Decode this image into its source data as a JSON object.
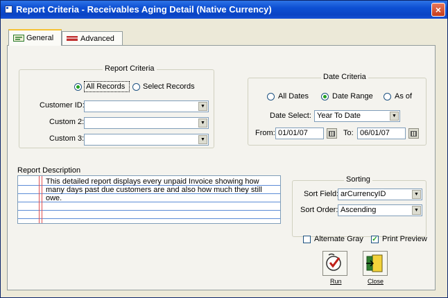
{
  "window": {
    "title": "Report Criteria - Receivables Aging Detail (Native Currency)",
    "close_glyph": "×"
  },
  "tabs": [
    {
      "label": "General",
      "icon": "form-icon"
    },
    {
      "label": "Advanced",
      "icon": "bar-icon"
    }
  ],
  "report_criteria": {
    "title": "Report Criteria",
    "radio_all": "All Records",
    "radio_select": "Select Records",
    "selected": "All Records",
    "customer_id_label": "Customer ID:",
    "custom2_label": "Custom 2:",
    "custom3_label": "Custom 3:",
    "customer_id_value": "",
    "custom2_value": "",
    "custom3_value": ""
  },
  "date_criteria": {
    "title": "Date Criteria",
    "radio_all_dates": "All Dates",
    "radio_date_range": "Date Range",
    "radio_as_of": "As of",
    "selected": "Date Range",
    "date_select_label": "Date Select:",
    "date_select_value": "Year To Date",
    "from_label": "From:",
    "from_value": "01/01/07",
    "to_label": "To:",
    "to_value": "06/01/07"
  },
  "report_description": {
    "label": "Report Description",
    "text": "This detailed report displays every unpaid Invoice showing how many days past due customers are and also how much they still owe."
  },
  "sorting": {
    "title": "Sorting",
    "sort_field_label": "Sort Field:",
    "sort_field_value": "arCurrencyID",
    "sort_order_label": "Sort Order:",
    "sort_order_value": "Ascending"
  },
  "options": {
    "alternate_gray_label": "Alternate Gray",
    "alternate_gray": false,
    "print_preview_label": "Print Preview",
    "print_preview": true
  },
  "buttons": {
    "run_label": "Run",
    "close_label": "Close"
  },
  "colors": {
    "titlebar": "#0a44c4",
    "accent_check": "#21a121",
    "tab_highlight": "#f5c133"
  }
}
